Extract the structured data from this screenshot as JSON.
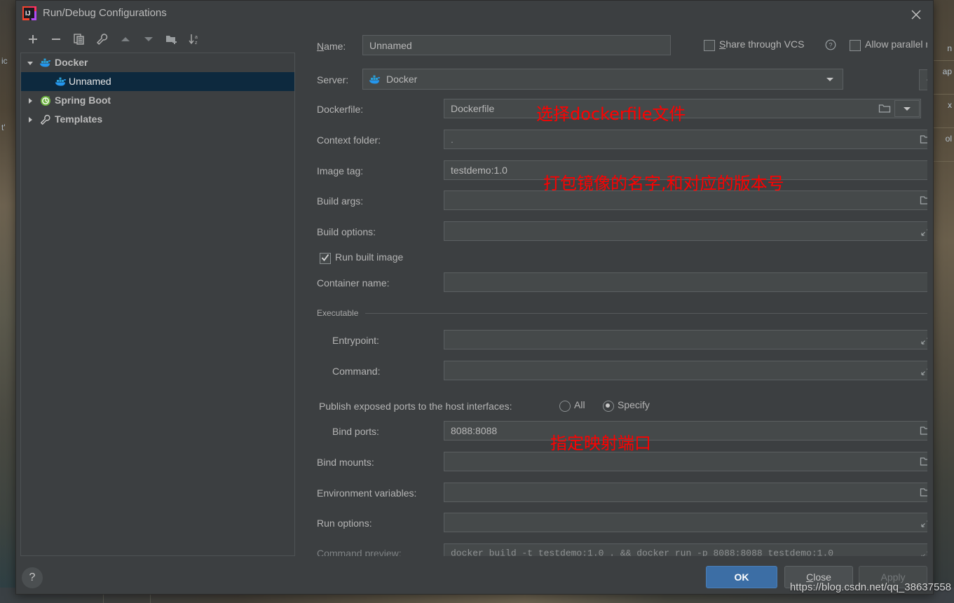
{
  "window": {
    "title": "Run/Debug Configurations",
    "app_icon": "intellij-idea-icon",
    "close_icon": "close-icon"
  },
  "toolbar": {
    "items": [
      {
        "name": "add-configuration-button",
        "icon": "plus-icon"
      },
      {
        "name": "remove-configuration-button",
        "icon": "minus-icon"
      },
      {
        "name": "copy-configuration-button",
        "icon": "copy-icon"
      },
      {
        "name": "edit-templates-button",
        "icon": "wrench-icon"
      },
      {
        "name": "move-up-button",
        "icon": "arrow-up-icon"
      },
      {
        "name": "move-down-button",
        "icon": "arrow-down-icon"
      },
      {
        "name": "new-folder-button",
        "icon": "folder-add-icon"
      },
      {
        "name": "sort-configurations-button",
        "icon": "sort-az-icon"
      }
    ]
  },
  "tree": {
    "nodes": [
      {
        "label": "Docker",
        "icon": "docker-icon",
        "expanded": true,
        "indent": 0,
        "selected": false,
        "bold": true
      },
      {
        "label": "Unnamed",
        "icon": "docker-icon",
        "expanded": null,
        "indent": 1,
        "selected": true,
        "bold": false
      },
      {
        "label": "Spring Boot",
        "icon": "spring-boot-icon",
        "expanded": false,
        "indent": 0,
        "selected": false,
        "bold": true
      },
      {
        "label": "Templates",
        "icon": "wrench-icon",
        "expanded": false,
        "indent": 0,
        "selected": false,
        "bold": true
      }
    ]
  },
  "form": {
    "name_label": "Name:",
    "name_label_mnemonic": "N",
    "name_value": "Unnamed",
    "share_vcs_label": "Share through VCS",
    "share_vcs_mnemonic": "S",
    "share_vcs_checked": false,
    "help_icon": "question-circle-icon",
    "allow_parallel_label": "Allow parallel run",
    "allow_parallel_checked": false,
    "server_label": "Server:",
    "server_value": "Docker",
    "server_icon": "docker-icon",
    "browse_label": "...",
    "dockerfile_label": "Dockerfile:",
    "dockerfile_value": "Dockerfile",
    "context_folder_label": "Context folder:",
    "context_folder_value": ".",
    "image_tag_label": "Image tag:",
    "image_tag_value": "testdemo:1.0",
    "build_args_label": "Build args:",
    "build_args_value": "",
    "build_options_label": "Build options:",
    "build_options_value": "",
    "run_built_image_label": "Run built image",
    "run_built_image_checked": true,
    "container_name_label": "Container name:",
    "container_name_value": "",
    "executable_group_label": "Executable",
    "entrypoint_label": "Entrypoint:",
    "entrypoint_value": "",
    "command_label": "Command:",
    "command_value": "",
    "publish_ports_label": "Publish exposed ports to the host interfaces:",
    "radio_all_label": "All",
    "radio_specify_label": "Specify",
    "ports_mode": "Specify",
    "bind_ports_label": "Bind ports:",
    "bind_ports_value": "8088:8088",
    "bind_mounts_label": "Bind mounts:",
    "bind_mounts_value": "",
    "env_vars_label": "Environment variables:",
    "env_vars_value": "",
    "run_options_label": "Run options:",
    "run_options_value": "",
    "command_preview_label": "Command preview:",
    "command_preview_value": "docker build -t testdemo:1.0 . && docker run -p 8088:8088 testdemo:1.0"
  },
  "annotations": [
    {
      "text": "选择dockerfile文件",
      "name": "annotation-select-dockerfile"
    },
    {
      "text": "打包镜像的名字,和对应的版本号",
      "name": "annotation-image-name-version"
    },
    {
      "text": "指定映射端口",
      "name": "annotation-bind-ports"
    }
  ],
  "footer": {
    "help_label": "?",
    "ok_label": "OK",
    "close_label": "Close",
    "close_mnemonic": "C",
    "apply_label": "Apply",
    "watermark": "https://blog.csdn.net/qq_38637558"
  },
  "background": {
    "left_texts": [
      "ic",
      "t'"
    ],
    "right_texts": [
      "n",
      "ap",
      "x",
      "ol"
    ]
  },
  "colors": {
    "dialog_bg": "#3c3f41",
    "field_bg": "#45494a",
    "selection": "#0d293e",
    "accent": "#3c6ea5",
    "annotation": "#ff0000",
    "text": "#b4b4b4"
  }
}
